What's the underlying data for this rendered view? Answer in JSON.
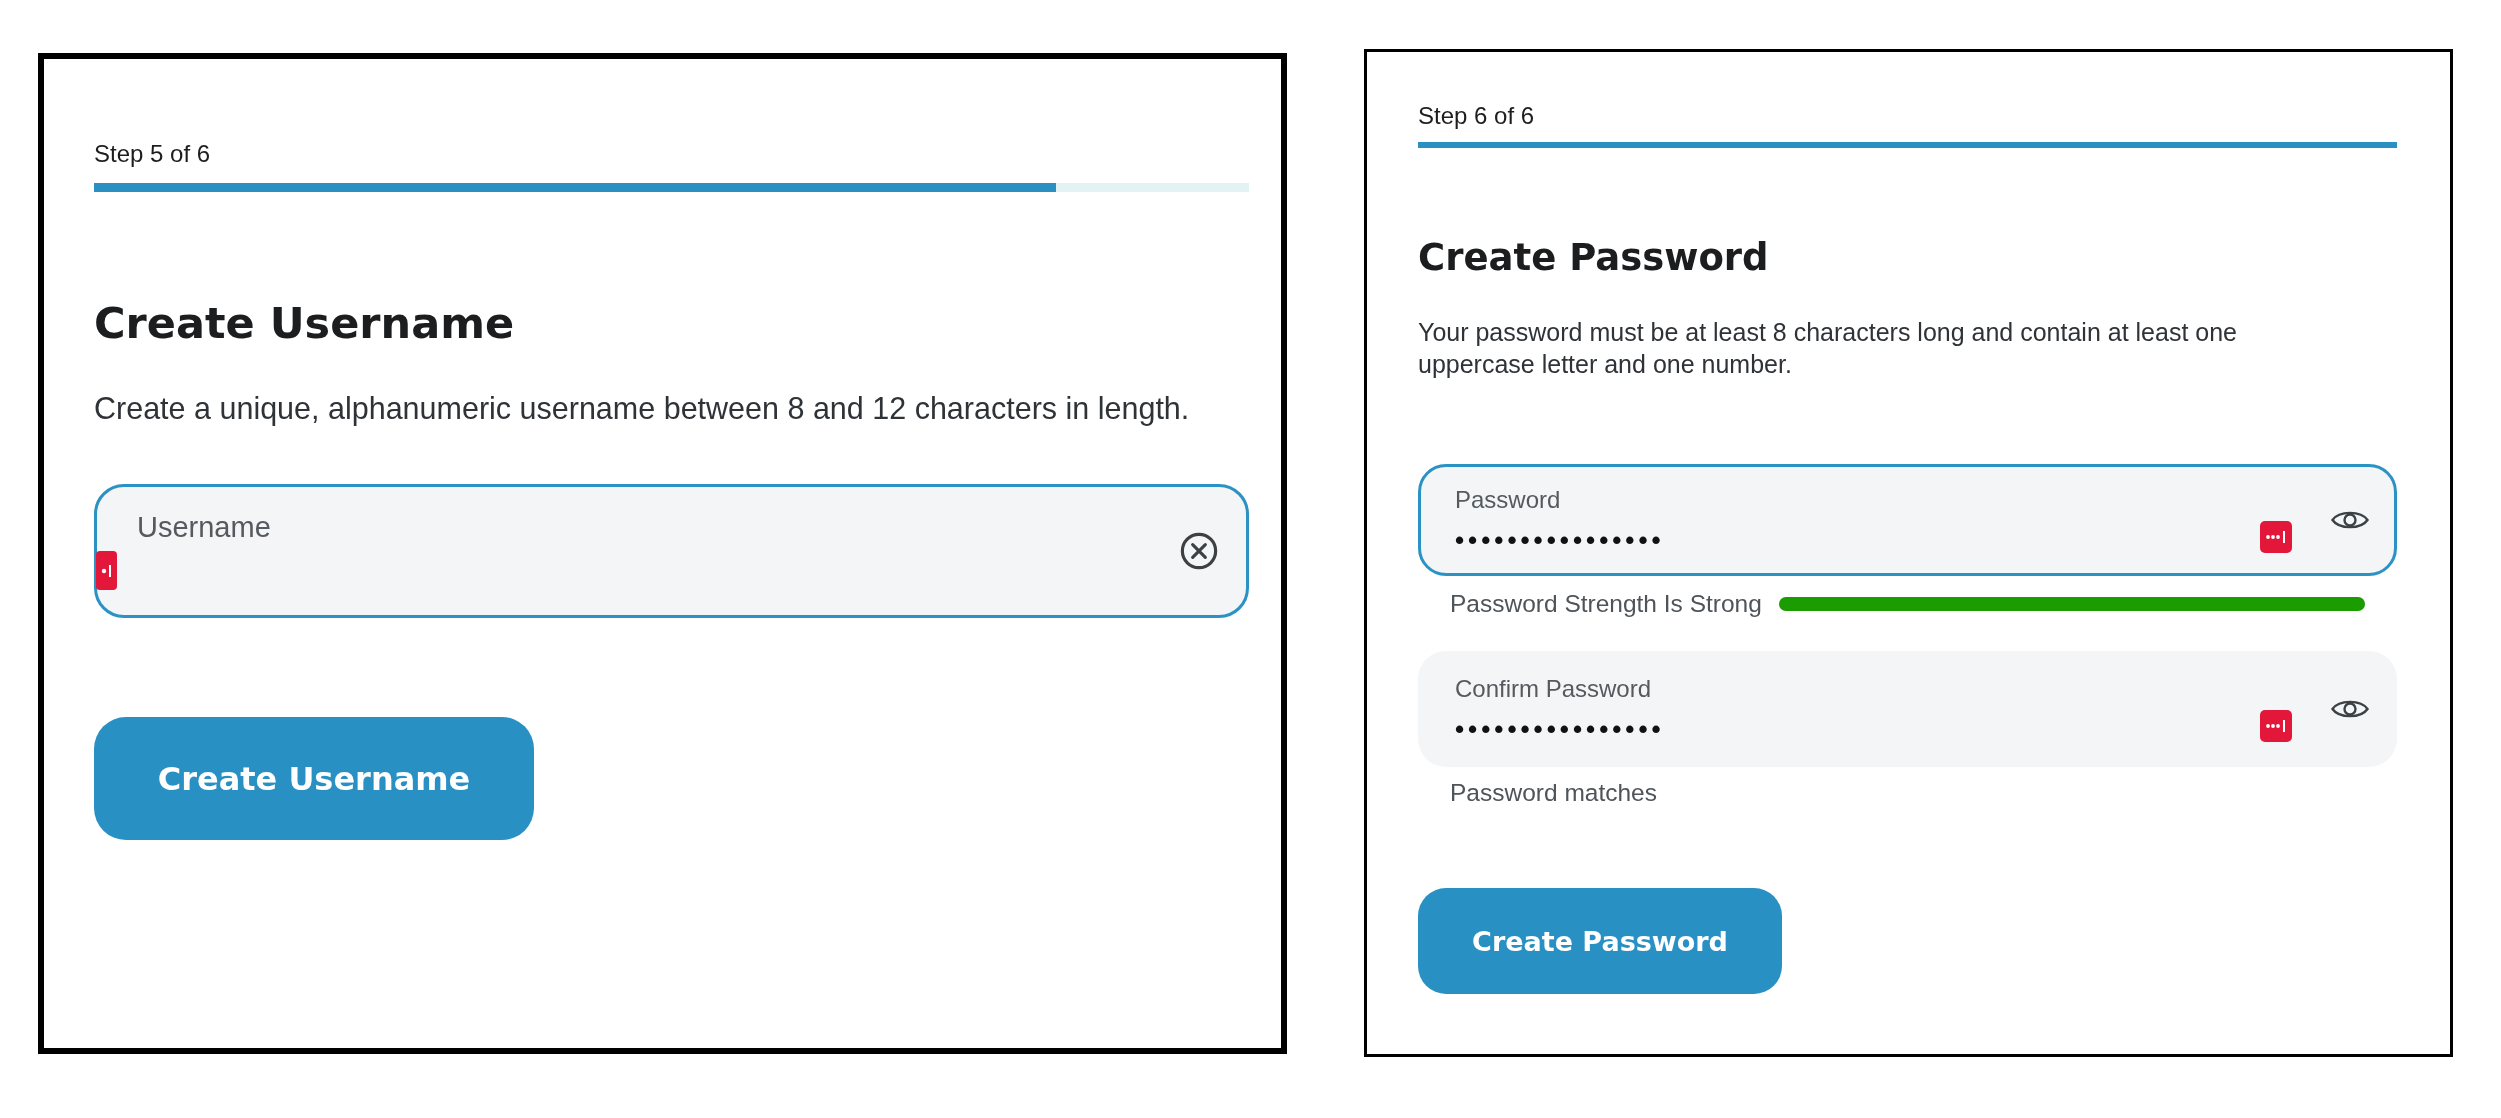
{
  "panels": [
    {
      "step": {
        "label": "Step 5 of 6",
        "level": 0.833
      },
      "title": "Create Username",
      "description": "Create a unique, alphanumeric username between 8 and 12 characters in length.",
      "fields": [
        {
          "kind": "text",
          "label": "Username",
          "focused": true
        }
      ],
      "button": "Create Username"
    },
    {
      "step": {
        "label": "Step 6 of 6",
        "level": 1
      },
      "title": "Create Password",
      "description": "Your password must be at least 8 characters long and contain at least one uppercase letter and one number.",
      "fields": [
        {
          "kind": "password",
          "label": "Password",
          "value": "••••••••••••••••",
          "focused": true,
          "strength": {
            "label": "Password Strength Is Strong",
            "level": 1
          }
        },
        {
          "kind": "password",
          "label": "Confirm Password",
          "value": "••••••••••••••••",
          "focused": false,
          "hint": "Password matches"
        }
      ],
      "button": "Create Password"
    }
  ]
}
